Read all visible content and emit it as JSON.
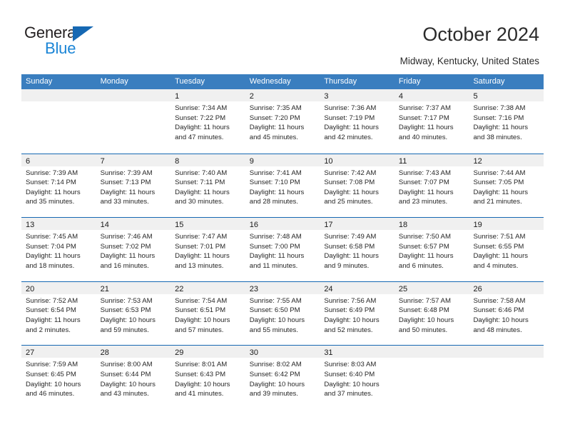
{
  "brand": {
    "word1": "General",
    "word2": "Blue",
    "triangle_color": "#1668b3",
    "word2_color": "#1b85d6"
  },
  "header": {
    "title": "October 2024",
    "location": "Midway, Kentucky, United States"
  },
  "calendar": {
    "header_bg": "#3a7ebf",
    "header_text_color": "#ffffff",
    "row_divider_color": "#1668b3",
    "daynum_band_bg": "#f0f0f0",
    "weekday_labels": [
      "Sunday",
      "Monday",
      "Tuesday",
      "Wednesday",
      "Thursday",
      "Friday",
      "Saturday"
    ],
    "weeks": [
      [
        {
          "day": "",
          "sunrise": "",
          "sunset": "",
          "daylight_line1": "",
          "daylight_line2": "",
          "empty": true
        },
        {
          "day": "",
          "sunrise": "",
          "sunset": "",
          "daylight_line1": "",
          "daylight_line2": "",
          "empty": true
        },
        {
          "day": "1",
          "sunrise": "Sunrise: 7:34 AM",
          "sunset": "Sunset: 7:22 PM",
          "daylight_line1": "Daylight: 11 hours",
          "daylight_line2": "and 47 minutes.",
          "empty": false
        },
        {
          "day": "2",
          "sunrise": "Sunrise: 7:35 AM",
          "sunset": "Sunset: 7:20 PM",
          "daylight_line1": "Daylight: 11 hours",
          "daylight_line2": "and 45 minutes.",
          "empty": false
        },
        {
          "day": "3",
          "sunrise": "Sunrise: 7:36 AM",
          "sunset": "Sunset: 7:19 PM",
          "daylight_line1": "Daylight: 11 hours",
          "daylight_line2": "and 42 minutes.",
          "empty": false
        },
        {
          "day": "4",
          "sunrise": "Sunrise: 7:37 AM",
          "sunset": "Sunset: 7:17 PM",
          "daylight_line1": "Daylight: 11 hours",
          "daylight_line2": "and 40 minutes.",
          "empty": false
        },
        {
          "day": "5",
          "sunrise": "Sunrise: 7:38 AM",
          "sunset": "Sunset: 7:16 PM",
          "daylight_line1": "Daylight: 11 hours",
          "daylight_line2": "and 38 minutes.",
          "empty": false
        }
      ],
      [
        {
          "day": "6",
          "sunrise": "Sunrise: 7:39 AM",
          "sunset": "Sunset: 7:14 PM",
          "daylight_line1": "Daylight: 11 hours",
          "daylight_line2": "and 35 minutes.",
          "empty": false
        },
        {
          "day": "7",
          "sunrise": "Sunrise: 7:39 AM",
          "sunset": "Sunset: 7:13 PM",
          "daylight_line1": "Daylight: 11 hours",
          "daylight_line2": "and 33 minutes.",
          "empty": false
        },
        {
          "day": "8",
          "sunrise": "Sunrise: 7:40 AM",
          "sunset": "Sunset: 7:11 PM",
          "daylight_line1": "Daylight: 11 hours",
          "daylight_line2": "and 30 minutes.",
          "empty": false
        },
        {
          "day": "9",
          "sunrise": "Sunrise: 7:41 AM",
          "sunset": "Sunset: 7:10 PM",
          "daylight_line1": "Daylight: 11 hours",
          "daylight_line2": "and 28 minutes.",
          "empty": false
        },
        {
          "day": "10",
          "sunrise": "Sunrise: 7:42 AM",
          "sunset": "Sunset: 7:08 PM",
          "daylight_line1": "Daylight: 11 hours",
          "daylight_line2": "and 25 minutes.",
          "empty": false
        },
        {
          "day": "11",
          "sunrise": "Sunrise: 7:43 AM",
          "sunset": "Sunset: 7:07 PM",
          "daylight_line1": "Daylight: 11 hours",
          "daylight_line2": "and 23 minutes.",
          "empty": false
        },
        {
          "day": "12",
          "sunrise": "Sunrise: 7:44 AM",
          "sunset": "Sunset: 7:05 PM",
          "daylight_line1": "Daylight: 11 hours",
          "daylight_line2": "and 21 minutes.",
          "empty": false
        }
      ],
      [
        {
          "day": "13",
          "sunrise": "Sunrise: 7:45 AM",
          "sunset": "Sunset: 7:04 PM",
          "daylight_line1": "Daylight: 11 hours",
          "daylight_line2": "and 18 minutes.",
          "empty": false
        },
        {
          "day": "14",
          "sunrise": "Sunrise: 7:46 AM",
          "sunset": "Sunset: 7:02 PM",
          "daylight_line1": "Daylight: 11 hours",
          "daylight_line2": "and 16 minutes.",
          "empty": false
        },
        {
          "day": "15",
          "sunrise": "Sunrise: 7:47 AM",
          "sunset": "Sunset: 7:01 PM",
          "daylight_line1": "Daylight: 11 hours",
          "daylight_line2": "and 13 minutes.",
          "empty": false
        },
        {
          "day": "16",
          "sunrise": "Sunrise: 7:48 AM",
          "sunset": "Sunset: 7:00 PM",
          "daylight_line1": "Daylight: 11 hours",
          "daylight_line2": "and 11 minutes.",
          "empty": false
        },
        {
          "day": "17",
          "sunrise": "Sunrise: 7:49 AM",
          "sunset": "Sunset: 6:58 PM",
          "daylight_line1": "Daylight: 11 hours",
          "daylight_line2": "and 9 minutes.",
          "empty": false
        },
        {
          "day": "18",
          "sunrise": "Sunrise: 7:50 AM",
          "sunset": "Sunset: 6:57 PM",
          "daylight_line1": "Daylight: 11 hours",
          "daylight_line2": "and 6 minutes.",
          "empty": false
        },
        {
          "day": "19",
          "sunrise": "Sunrise: 7:51 AM",
          "sunset": "Sunset: 6:55 PM",
          "daylight_line1": "Daylight: 11 hours",
          "daylight_line2": "and 4 minutes.",
          "empty": false
        }
      ],
      [
        {
          "day": "20",
          "sunrise": "Sunrise: 7:52 AM",
          "sunset": "Sunset: 6:54 PM",
          "daylight_line1": "Daylight: 11 hours",
          "daylight_line2": "and 2 minutes.",
          "empty": false
        },
        {
          "day": "21",
          "sunrise": "Sunrise: 7:53 AM",
          "sunset": "Sunset: 6:53 PM",
          "daylight_line1": "Daylight: 10 hours",
          "daylight_line2": "and 59 minutes.",
          "empty": false
        },
        {
          "day": "22",
          "sunrise": "Sunrise: 7:54 AM",
          "sunset": "Sunset: 6:51 PM",
          "daylight_line1": "Daylight: 10 hours",
          "daylight_line2": "and 57 minutes.",
          "empty": false
        },
        {
          "day": "23",
          "sunrise": "Sunrise: 7:55 AM",
          "sunset": "Sunset: 6:50 PM",
          "daylight_line1": "Daylight: 10 hours",
          "daylight_line2": "and 55 minutes.",
          "empty": false
        },
        {
          "day": "24",
          "sunrise": "Sunrise: 7:56 AM",
          "sunset": "Sunset: 6:49 PM",
          "daylight_line1": "Daylight: 10 hours",
          "daylight_line2": "and 52 minutes.",
          "empty": false
        },
        {
          "day": "25",
          "sunrise": "Sunrise: 7:57 AM",
          "sunset": "Sunset: 6:48 PM",
          "daylight_line1": "Daylight: 10 hours",
          "daylight_line2": "and 50 minutes.",
          "empty": false
        },
        {
          "day": "26",
          "sunrise": "Sunrise: 7:58 AM",
          "sunset": "Sunset: 6:46 PM",
          "daylight_line1": "Daylight: 10 hours",
          "daylight_line2": "and 48 minutes.",
          "empty": false
        }
      ],
      [
        {
          "day": "27",
          "sunrise": "Sunrise: 7:59 AM",
          "sunset": "Sunset: 6:45 PM",
          "daylight_line1": "Daylight: 10 hours",
          "daylight_line2": "and 46 minutes.",
          "empty": false
        },
        {
          "day": "28",
          "sunrise": "Sunrise: 8:00 AM",
          "sunset": "Sunset: 6:44 PM",
          "daylight_line1": "Daylight: 10 hours",
          "daylight_line2": "and 43 minutes.",
          "empty": false
        },
        {
          "day": "29",
          "sunrise": "Sunrise: 8:01 AM",
          "sunset": "Sunset: 6:43 PM",
          "daylight_line1": "Daylight: 10 hours",
          "daylight_line2": "and 41 minutes.",
          "empty": false
        },
        {
          "day": "30",
          "sunrise": "Sunrise: 8:02 AM",
          "sunset": "Sunset: 6:42 PM",
          "daylight_line1": "Daylight: 10 hours",
          "daylight_line2": "and 39 minutes.",
          "empty": false
        },
        {
          "day": "31",
          "sunrise": "Sunrise: 8:03 AM",
          "sunset": "Sunset: 6:40 PM",
          "daylight_line1": "Daylight: 10 hours",
          "daylight_line2": "and 37 minutes.",
          "empty": false
        },
        {
          "day": "",
          "sunrise": "",
          "sunset": "",
          "daylight_line1": "",
          "daylight_line2": "",
          "empty": true
        },
        {
          "day": "",
          "sunrise": "",
          "sunset": "",
          "daylight_line1": "",
          "daylight_line2": "",
          "empty": true
        }
      ]
    ]
  }
}
